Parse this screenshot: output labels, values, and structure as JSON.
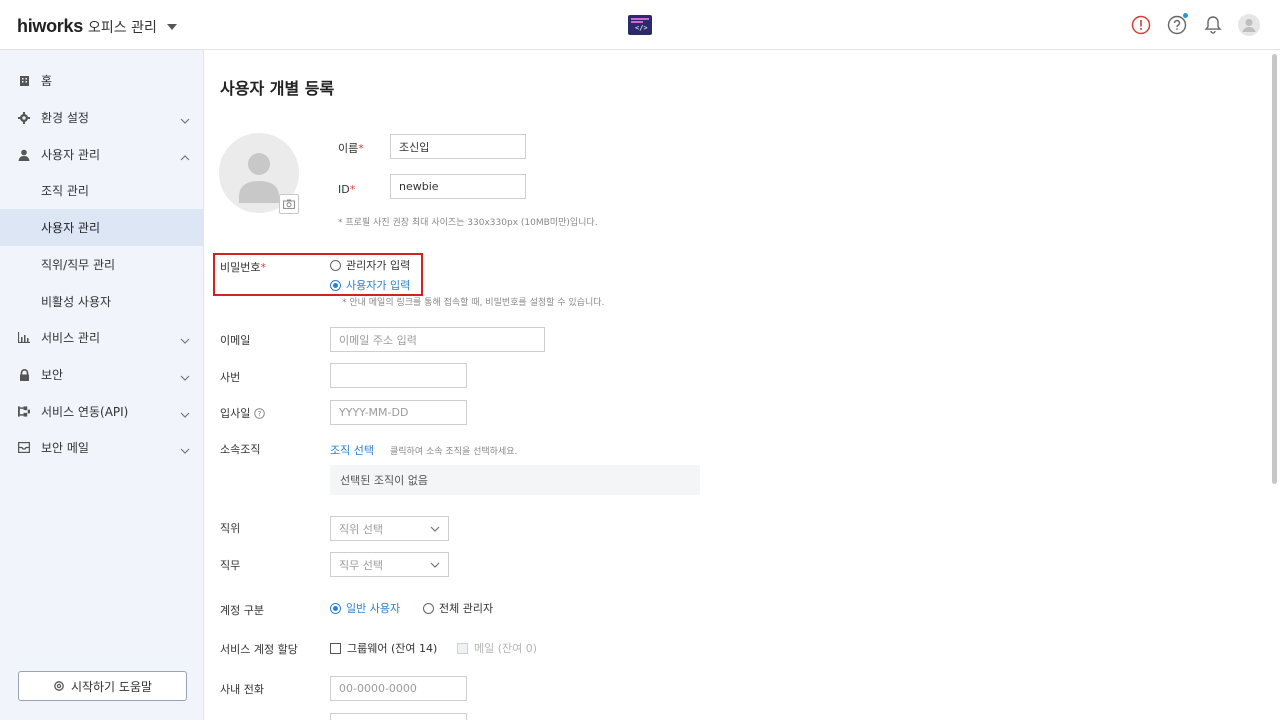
{
  "header": {
    "logo": "hiworks",
    "office_menu": "오피스 관리",
    "icons": [
      "alert-circle-icon",
      "help-icon",
      "bell-icon",
      "user-avatar-icon"
    ]
  },
  "sidebar": {
    "items": [
      {
        "label": "홈",
        "icon": "home-icon"
      },
      {
        "label": "환경 설정",
        "icon": "gear-icon"
      },
      {
        "label": "사용자 관리",
        "icon": "user-icon"
      },
      {
        "label": "서비스 관리",
        "icon": "chart-icon"
      },
      {
        "label": "보안",
        "icon": "lock-icon"
      },
      {
        "label": "서비스 연동(API)",
        "icon": "api-icon"
      },
      {
        "label": "보안 메일",
        "icon": "mail-icon"
      }
    ],
    "sub_items": [
      "조직 관리",
      "사용자 관리",
      "직위/직무 관리",
      "비활성 사용자"
    ],
    "active_sub": "사용자 관리",
    "help_button": "시작하기 도움말"
  },
  "form": {
    "title": "사용자 개별 등록",
    "name_label": "이름",
    "name_value": "조신입",
    "id_label": "ID",
    "id_value": "newbie",
    "photo_note": "* 프로필 사진 권장 최대 사이즈는 330x330px (10MB미만)입니다.",
    "password_label": "비밀번호",
    "password_option_admin": "관리자가 입력",
    "password_option_user": "사용자가 입력",
    "password_note": "* 안내 메일의 링크를 통해 접속할 때, 비밀번호를 설정할 수 있습니다.",
    "email_label": "이메일",
    "email_placeholder": "이메일 주소 입력",
    "empno_label": "사번",
    "joindate_label": "입사일",
    "joindate_placeholder": "YYYY-MM-DD",
    "org_label": "소속조직",
    "org_link": "조직 선택",
    "org_hint": "클릭하여 소속 조직을 선택하세요.",
    "org_empty": "선택된 조직이 없음",
    "position_label": "직위",
    "position_placeholder": "직위 선택",
    "duty_label": "직무",
    "duty_placeholder": "직무 선택",
    "account_type_label": "계정 구분",
    "account_type_general": "일반 사용자",
    "account_type_admin": "전체 관리자",
    "service_label": "서비스 계정 할당",
    "groupware_check": "그룹웨어 (잔여 14)",
    "mail_check": "메일 (잔여 0)",
    "phone_label": "사내 전화",
    "phone_placeholder": "00-0000-0000"
  },
  "colors": {
    "accent": "#2b7fd4",
    "highlight_border": "#d32020",
    "sidebar_bg": "#f1f4fa",
    "sidebar_active": "#dde6f4",
    "required": "#e03a3a"
  }
}
